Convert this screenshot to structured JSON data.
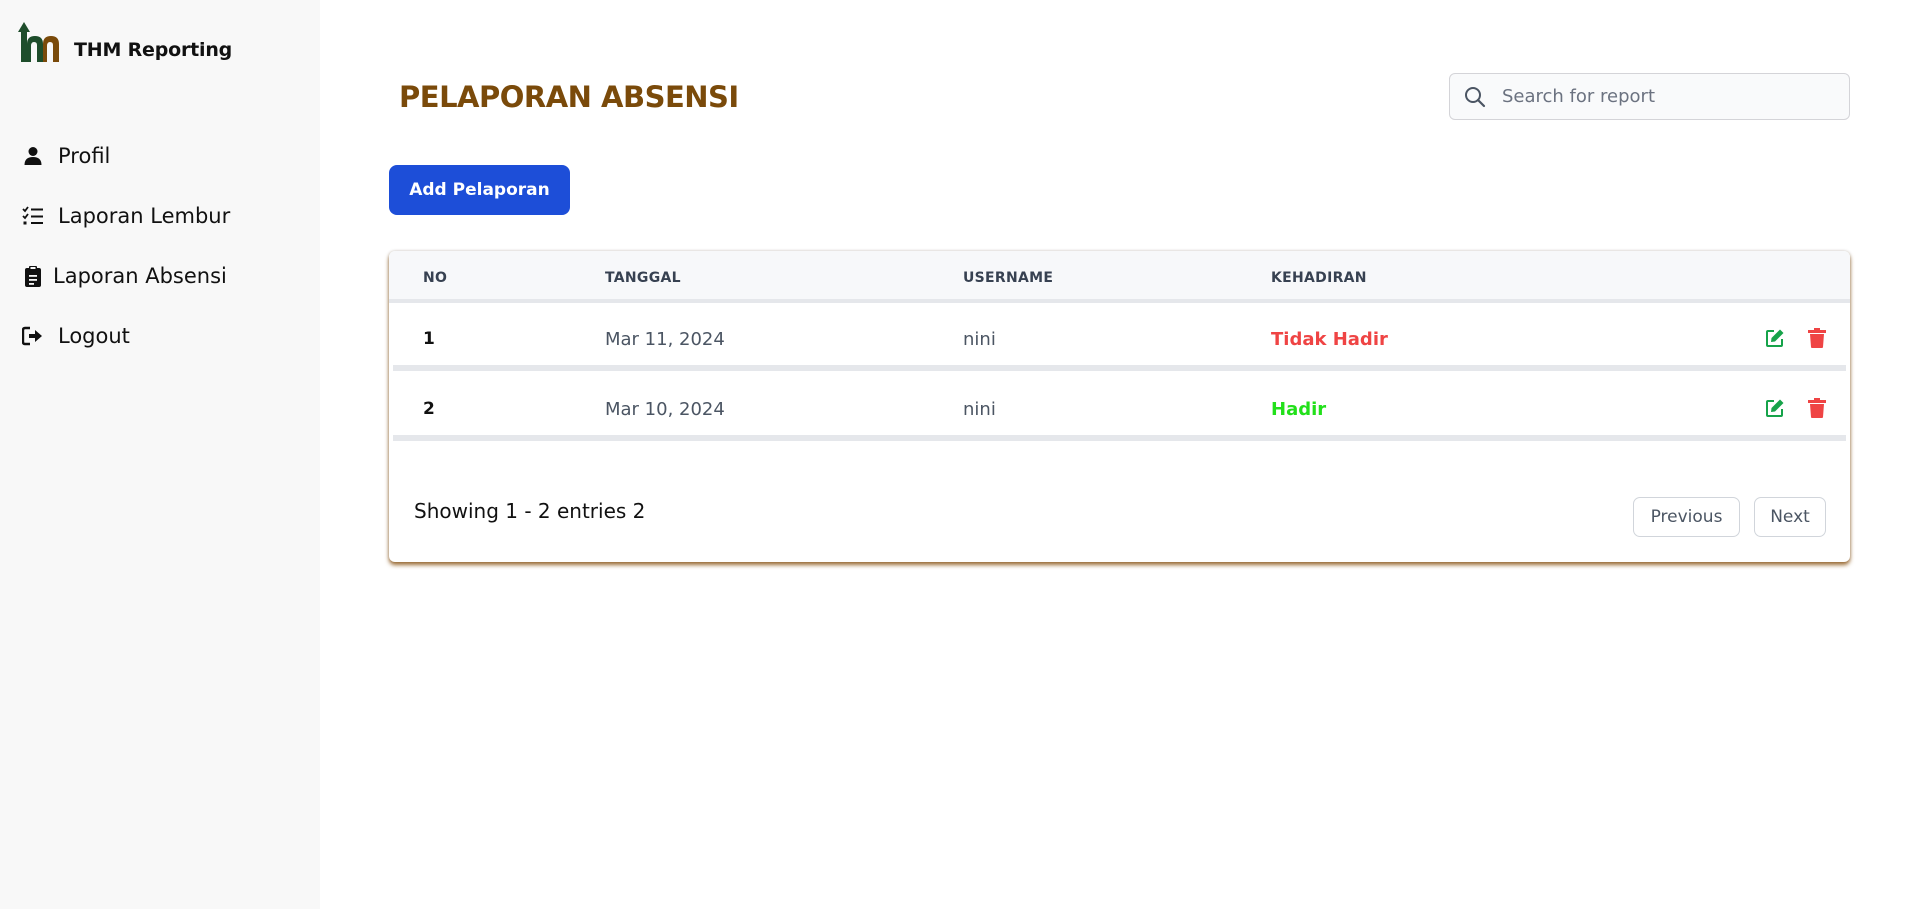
{
  "app": {
    "title": "THM Reporting"
  },
  "sidebar": {
    "items": [
      {
        "label": "Profil",
        "icon": "user-icon"
      },
      {
        "label": "Laporan Lembur",
        "icon": "checklist-icon"
      },
      {
        "label": "Laporan Absensi",
        "icon": "clipboard-icon"
      },
      {
        "label": "Logout",
        "icon": "logout-icon"
      }
    ]
  },
  "main": {
    "title": "PELAPORAN ABSENSI",
    "search": {
      "placeholder": "Search for report",
      "value": ""
    },
    "add_button": "Add Pelaporan"
  },
  "table": {
    "columns": [
      "NO",
      "TANGGAL",
      "USERNAME",
      "KEHADIRAN"
    ],
    "rows": [
      {
        "no": "1",
        "tanggal": "Mar 11, 2024",
        "username": "nini",
        "kehadiran": "Tidak Hadir"
      },
      {
        "no": "2",
        "tanggal": "Mar 10, 2024",
        "username": "nini",
        "kehadiran": "Hadir"
      }
    ]
  },
  "pagination": {
    "summary": "Showing 1 - 2 entries 2",
    "previous": "Previous",
    "next": "Next"
  },
  "colors": {
    "title": "#7a4a0a",
    "primary_button": "#1d4ed8",
    "status_absent": "#ef4444",
    "status_present": "#22e01a",
    "edit_icon": "#16a34a",
    "delete_icon": "#ef4444",
    "logo_green": "#1e4d2b",
    "logo_brown": "#7a4a0a"
  }
}
